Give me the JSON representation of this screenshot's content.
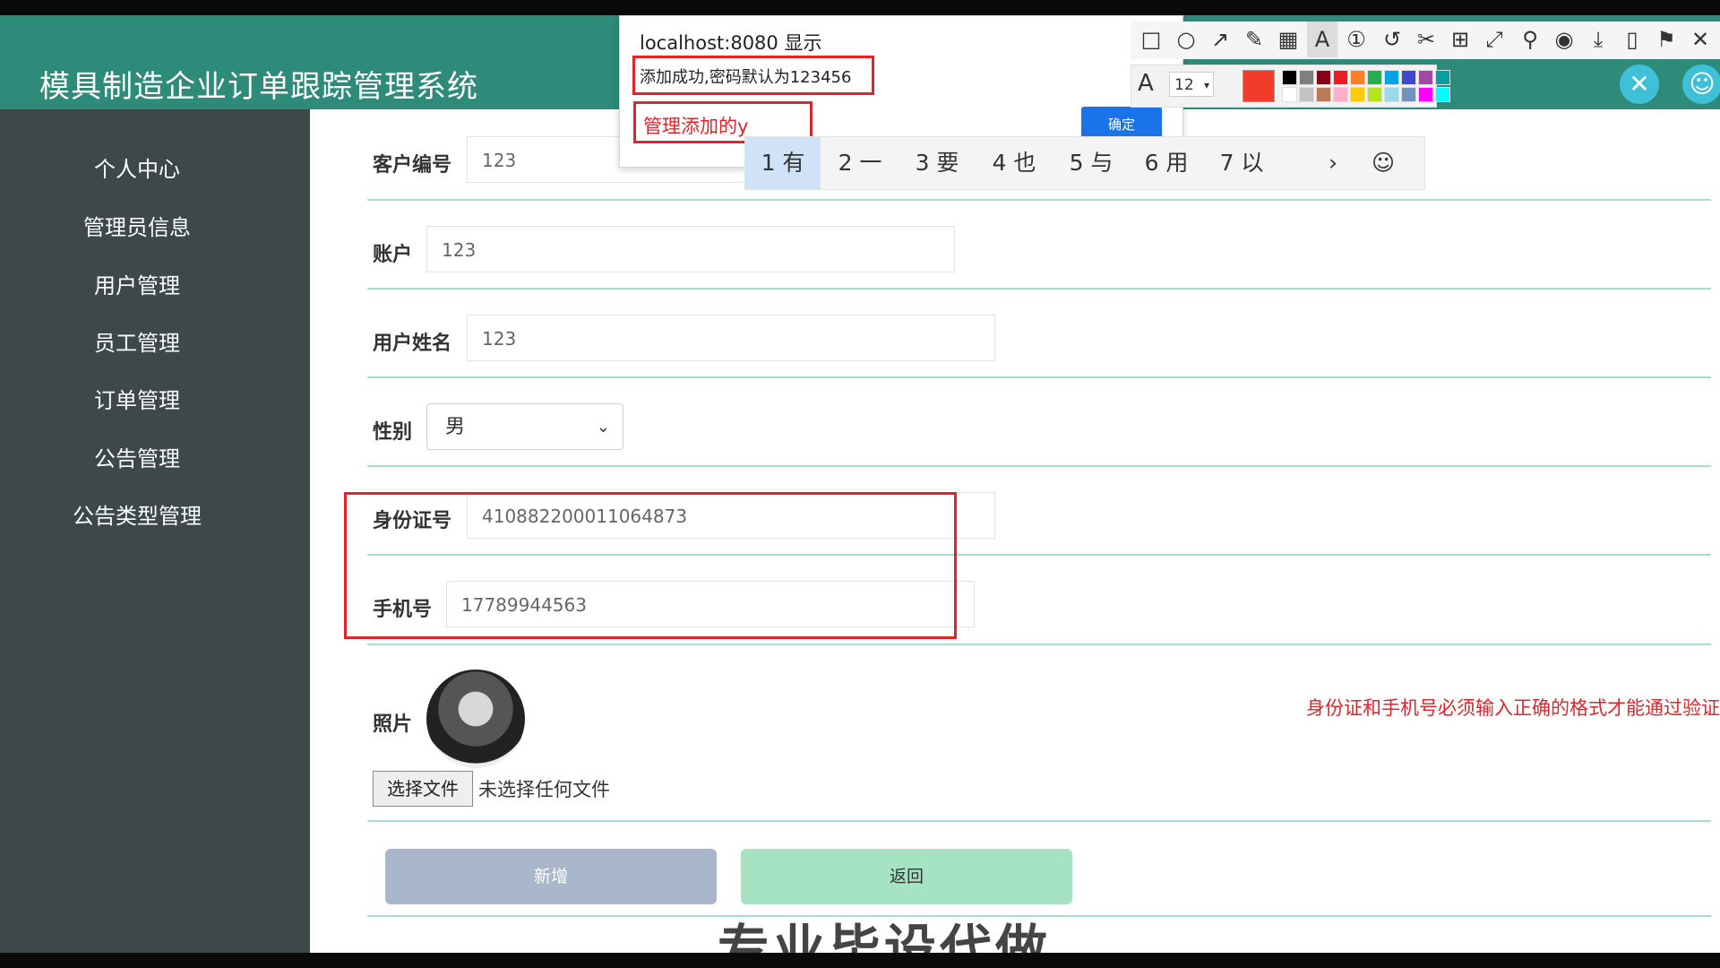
{
  "app": {
    "title": "模具制造企业订单跟踪管理系统"
  },
  "sidebar": {
    "items": [
      {
        "label": "个人中心"
      },
      {
        "label": "管理员信息"
      },
      {
        "label": "用户管理"
      },
      {
        "label": "员工管理"
      },
      {
        "label": "订单管理"
      },
      {
        "label": "公告管理"
      },
      {
        "label": "公告类型管理"
      }
    ]
  },
  "form": {
    "customer_no": {
      "label": "客户编号",
      "value": "123"
    },
    "account": {
      "label": "账户",
      "value": "123"
    },
    "username": {
      "label": "用户姓名",
      "value": "123"
    },
    "gender": {
      "label": "性别",
      "value": "男"
    },
    "id_card": {
      "label": "身份证号",
      "value": "410882200011064873"
    },
    "phone": {
      "label": "手机号",
      "value": "17789944563"
    },
    "photo": {
      "label": "照片"
    },
    "file_button": "选择文件",
    "file_status": "未选择任何文件",
    "validation_note": "身份证和手机号必须输入正确的格式才能通过验证",
    "submit_label": "新增",
    "back_label": "返回"
  },
  "dialog": {
    "origin": "localhost:8080 显示",
    "message": "添加成功,密码默认为123456",
    "ok_label": "确定"
  },
  "annotation": {
    "text": "管理添加的y"
  },
  "ime": {
    "candidates": [
      "1 有",
      "2 一",
      "3 要",
      "4 也",
      "5 与",
      "6 用",
      "7 以"
    ],
    "next": "›",
    "emoji": "☺"
  },
  "toolbar": {
    "font_size": "12",
    "current_color": "#f23b2b",
    "swatches": [
      "#000000",
      "#7f7f7f",
      "#880015",
      "#ed1c24",
      "#ff7f27",
      "#22b14c",
      "#00a2e8",
      "#3f48cc",
      "#a349a4",
      "#00a0a0",
      "#ffffff",
      "#c3c3c3",
      "#b97a57",
      "#ffaec9",
      "#ffc90e",
      "#b5e61d",
      "#99d9ea",
      "#7092be",
      "#ff00ff",
      "#00ffff"
    ]
  },
  "watermark": "专业毕设代做"
}
